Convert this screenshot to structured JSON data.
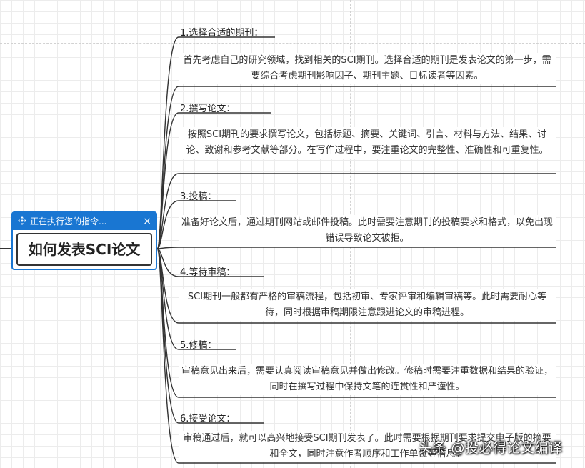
{
  "status": {
    "text": "正在执行您的指令...",
    "close": "×"
  },
  "root": {
    "title": "如何发表SCI论文"
  },
  "topics": [
    {
      "title": "1.选择合适的期刊：",
      "desc": "首先考虑自己的研究领域，找到相关的SCI期刊。选择合适的期刊是发表论文的第一步，需要综合考虑期刊影响因子、期刊主题、目标读者等因素。"
    },
    {
      "title": "2.撰写论文：",
      "desc": "按照SCI期刊的要求撰写论文，包括标题、摘要、关键词、引言、材料与方法、结果、讨论、致谢和参考文献等部分。在写作过程中，要注重论文的完整性、准确性和可重复性。"
    },
    {
      "title": "3.投稿：",
      "desc": "准备好论文后，通过期刊网站或邮件投稿。此时需要注意期刊的投稿要求和格式，以免出现错误导致论文被拒。"
    },
    {
      "title": "4.等待审稿：",
      "desc": "SCI期刊一般都有严格的审稿流程，包括初审、专家评审和编辑审稿等。此时需要耐心等待，同时根据审稿期限注意跟进论文的审稿进程。"
    },
    {
      "title": "5.修稿：",
      "desc": "审稿意见出来后，需要认真阅读审稿意见并做出修改。修稿时需要注重数据和结果的验证，同时在撰写过程中保持文笔的连贯性和严谨性。"
    },
    {
      "title": "6.接受论文：",
      "desc": "审稿通过后，就可以高兴地接受SCI期刊发表了。此时需要根据期刊要求提交电子版的摘要和全文，同时注意作者顺序和工作单位等信息。"
    }
  ],
  "watermark": "头条 @投必得论文编译"
}
